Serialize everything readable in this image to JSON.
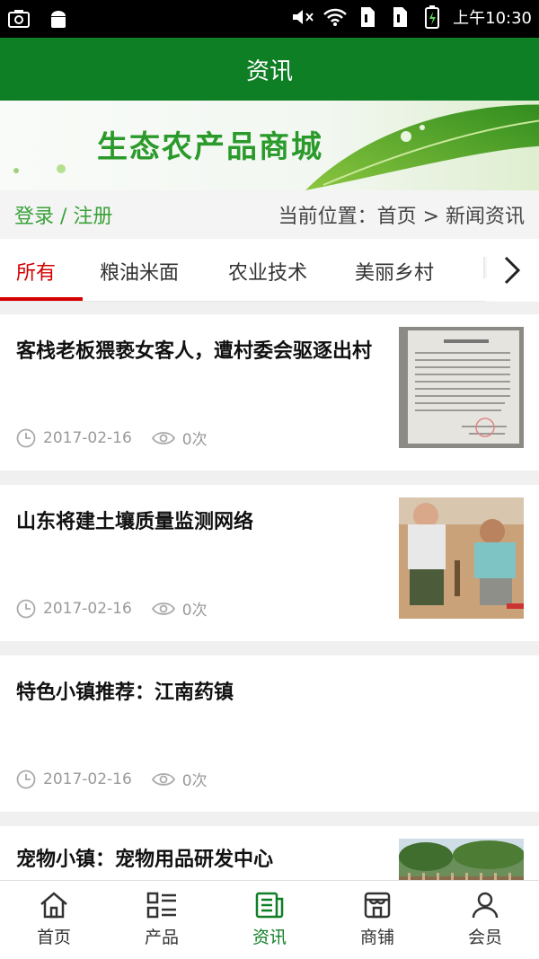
{
  "statusbar": {
    "time": "上午10:30"
  },
  "header": {
    "title": "资讯"
  },
  "banner": {
    "title": "生态农产品商城"
  },
  "navbar": {
    "login": "登录 / 注册",
    "breadcrumb": "当前位置：首页 > 新闻资讯"
  },
  "tabs": [
    "所有",
    "粮油米面",
    "农业技术",
    "美丽乡村"
  ],
  "articles": [
    {
      "title": "客栈老板猥亵女客人，遭村委会驱逐出村",
      "date": "2017-02-16",
      "views": "0次",
      "thumb": "notice-paper"
    },
    {
      "title": "山东将建土壤质量监测网络",
      "date": "2017-02-16",
      "views": "0次",
      "thumb": "soil-sampling"
    },
    {
      "title": "特色小镇推荐：江南药镇",
      "date": "2017-02-16",
      "views": "0次",
      "thumb": ""
    },
    {
      "title": "宠物小镇：宠物用品研发中心",
      "date": "",
      "views": "",
      "thumb": "trees-fence"
    }
  ],
  "bottomnav": [
    {
      "label": "首页",
      "icon": "home-icon"
    },
    {
      "label": "产品",
      "icon": "product-list-icon"
    },
    {
      "label": "资讯",
      "icon": "news-icon",
      "active": true
    },
    {
      "label": "商铺",
      "icon": "shop-icon"
    },
    {
      "label": "会员",
      "icon": "member-icon"
    }
  ],
  "colors": {
    "primary": "#0f7f26",
    "accent": "#d40000",
    "login": "#3aa13a"
  }
}
